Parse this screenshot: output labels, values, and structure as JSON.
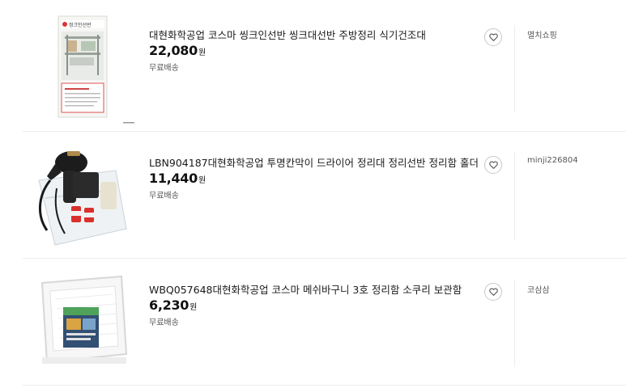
{
  "products": [
    {
      "title": "대현화학공업 코스마 씽크인선반 씽크대선반 주방정리 식기건조대",
      "price": "22,080",
      "unit": "원",
      "shipping": "무료배송",
      "seller": "멸치쇼핑",
      "thumb_text": "씽크인선반"
    },
    {
      "title": "LBN904187대현화학공업 투명칸막이 드라이어 정리대 정리선반 정리함 홀더",
      "price": "11,440",
      "unit": "원",
      "shipping": "무료배송",
      "seller": "minji226804"
    },
    {
      "title": "WBQ057648대현화학공업 코스마 메쉬바구니 3호 정리함 소쿠리 보관함",
      "price": "6,230",
      "unit": "원",
      "shipping": "무료배송",
      "seller": "코삼삼"
    }
  ],
  "icons": {
    "wishlist": "heart-outline-icon"
  },
  "colors": {
    "divider": "#ececec",
    "text": "#1a1a1a",
    "muted": "#555555"
  }
}
